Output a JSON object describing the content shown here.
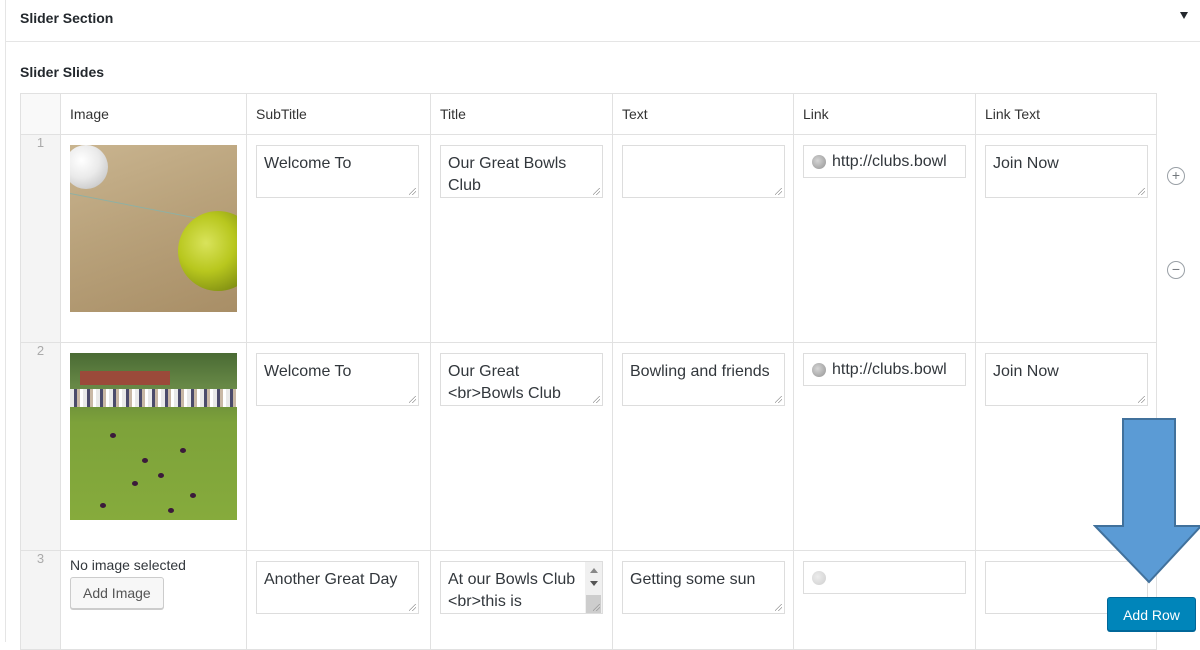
{
  "section": {
    "title": "Slider Section"
  },
  "field": {
    "label": "Slider Slides"
  },
  "table": {
    "columns": [
      "Image",
      "SubTitle",
      "Title",
      "Text",
      "Link",
      "Link Text"
    ],
    "rows": [
      {
        "order": "1",
        "image": "bowls-closeup-image",
        "subtitle": "Welcome To",
        "title": "Our Great Bowls Club",
        "text": "",
        "link": "http://clubs.bowl",
        "link_text": "Join Now"
      },
      {
        "order": "2",
        "image": "bowls-green-image",
        "subtitle": "Welcome To",
        "title": "Our Great <br>Bowls Club",
        "text": "Bowling and friends",
        "link": "http://clubs.bowl",
        "link_text": "Join Now"
      },
      {
        "order": "3",
        "image": "",
        "no_image_text": "No image selected",
        "add_image_label": "Add Image",
        "subtitle": "Another Great Day",
        "title": "At our Bowls Club <br>this is",
        "text": "Getting some sun",
        "link": "",
        "link_text": ""
      }
    ]
  },
  "row_controls": {
    "add_icon": "+",
    "remove_icon": "−"
  },
  "add_row_label": "Add Row",
  "colors": {
    "primary_button": "#0085ba",
    "arrow": "#5b9bd5"
  }
}
